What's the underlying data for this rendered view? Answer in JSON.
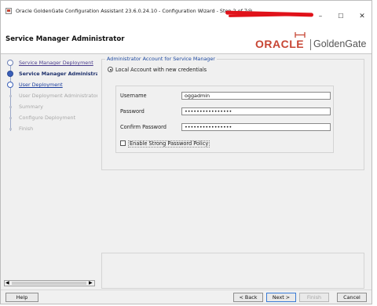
{
  "window": {
    "title": "Oracle GoldenGate Configuration Assistant 23.6.0.24.10 - Configuration Wizard - Step 2 of 7@",
    "minimize": "–",
    "maximize": "☐",
    "close": "✕"
  },
  "header": {
    "title": "Service Manager Administrator",
    "logo_brand": "ORACLE",
    "logo_product": "GoldenGate"
  },
  "nav": {
    "steps": [
      {
        "label": "Service Manager Deployment",
        "state": "done"
      },
      {
        "label": "Service Manager Administrator",
        "state": "current"
      },
      {
        "label": "User Deployment",
        "state": "next"
      },
      {
        "label": "User Deployment Administrator",
        "state": "future"
      },
      {
        "label": "Summary",
        "state": "future"
      },
      {
        "label": "Configure Deployment",
        "state": "future"
      },
      {
        "label": "Finish",
        "state": "future"
      }
    ],
    "scroll_left": "◀",
    "scroll_right": "▶"
  },
  "account_group": {
    "legend": "Administrator Account for Service Manager",
    "radio_label": "Local Account with new credentials",
    "username_label": "Username",
    "username_value": "oggadmin",
    "password_label": "Password",
    "password_value": "••••••••••••••••",
    "confirm_label": "Confirm Password",
    "confirm_value": "••••••••••••••••",
    "strong_policy_label": "Enable Strong Password Policy"
  },
  "buttons": {
    "help": "Help",
    "back": "< Back",
    "next": "Next >",
    "finish": "Finish",
    "cancel": "Cancel"
  },
  "colors": {
    "oracle_red": "#c74634",
    "nav_current": "#3a5fb8",
    "legend_blue": "#1f4aa0"
  }
}
